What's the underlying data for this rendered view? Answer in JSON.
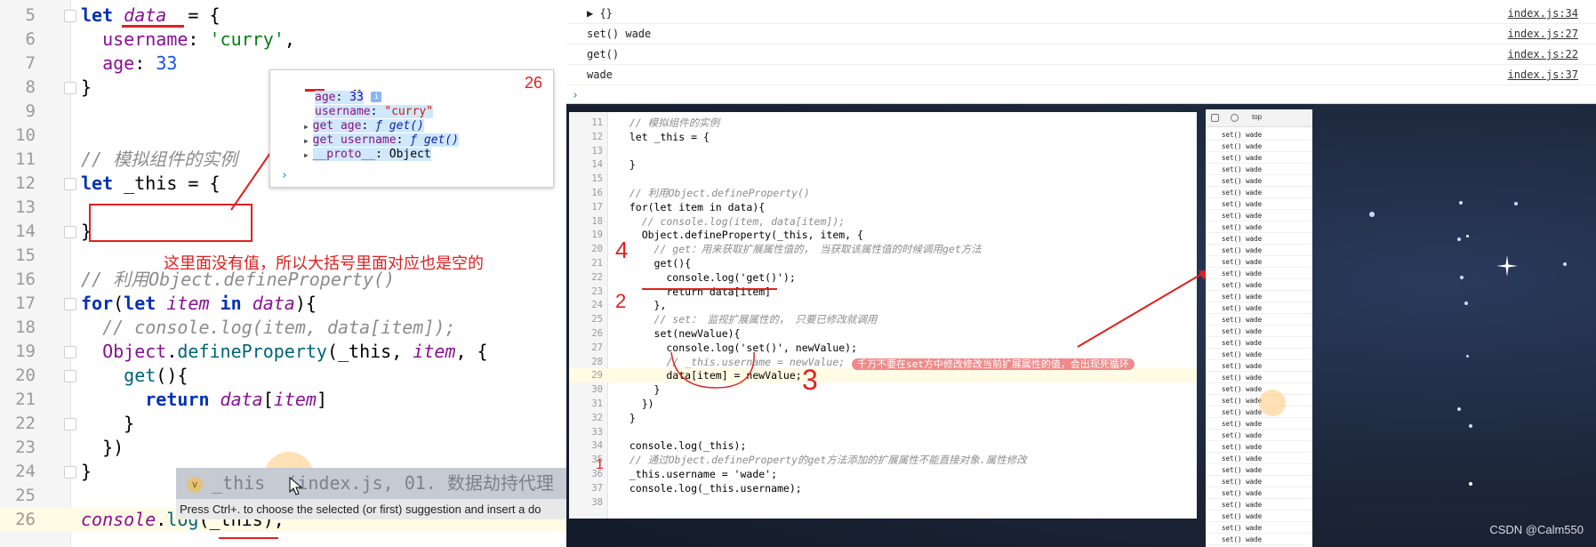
{
  "left_editor": {
    "lines": [
      {
        "n": "5",
        "parts": [
          [
            "kw",
            "let "
          ],
          [
            "ital",
            "data"
          ],
          [
            "",
            "  = {"
          ]
        ]
      },
      {
        "n": "6",
        "parts": [
          [
            "",
            "  "
          ],
          [
            "prop",
            "username"
          ],
          [
            "",
            ": "
          ],
          [
            "str",
            "'curry'"
          ],
          [
            "",
            ","
          ]
        ]
      },
      {
        "n": "7",
        "parts": [
          [
            "",
            "  "
          ],
          [
            "prop",
            "age"
          ],
          [
            "",
            ": "
          ],
          [
            "num-lit",
            "33"
          ]
        ]
      },
      {
        "n": "8",
        "parts": [
          [
            "",
            "}"
          ]
        ]
      },
      {
        "n": "9",
        "parts": []
      },
      {
        "n": "10",
        "parts": []
      },
      {
        "n": "11",
        "parts": [
          [
            "cmt",
            "// 模拟组件的实例"
          ]
        ]
      },
      {
        "n": "12",
        "parts": [
          [
            "kw",
            "let "
          ],
          [
            "",
            "_this = {"
          ]
        ]
      },
      {
        "n": "13",
        "parts": []
      },
      {
        "n": "14",
        "parts": [
          [
            "",
            "}"
          ]
        ]
      },
      {
        "n": "15",
        "parts": []
      },
      {
        "n": "16",
        "parts": [
          [
            "cmt",
            "// 利用Object.defineProperty()"
          ]
        ]
      },
      {
        "n": "17",
        "parts": [
          [
            "kw",
            "for"
          ],
          [
            "",
            "("
          ],
          [
            "kw",
            "let "
          ],
          [
            "ital",
            "item"
          ],
          [
            "kw",
            " in "
          ],
          [
            "ital",
            "data"
          ],
          [
            "",
            "){"
          ]
        ]
      },
      {
        "n": "18",
        "parts": [
          [
            "cmt",
            "  // console.log(item, data[item]);"
          ]
        ]
      },
      {
        "n": "19",
        "parts": [
          [
            "",
            "  "
          ],
          [
            "prop",
            "Object"
          ],
          [
            "",
            "."
          ],
          [
            "fn",
            "defineProperty"
          ],
          [
            "",
            "(_this, "
          ],
          [
            "ital",
            "item"
          ],
          [
            "",
            ", {"
          ]
        ]
      },
      {
        "n": "20",
        "parts": [
          [
            "",
            "    "
          ],
          [
            "fn",
            "get"
          ],
          [
            "",
            "(){"
          ]
        ]
      },
      {
        "n": "21",
        "parts": [
          [
            "",
            "      "
          ],
          [
            "kw",
            "return "
          ],
          [
            "ital",
            "data"
          ],
          [
            "",
            "["
          ],
          [
            "ital",
            "item"
          ],
          [
            "",
            "]"
          ]
        ]
      },
      {
        "n": "22",
        "parts": [
          [
            "",
            "    }"
          ]
        ]
      },
      {
        "n": "23",
        "parts": [
          [
            "",
            "  })"
          ]
        ]
      },
      {
        "n": "24",
        "parts": [
          [
            "",
            "}"
          ]
        ]
      },
      {
        "n": "25",
        "parts": []
      },
      {
        "n": "26",
        "parts": [
          [
            "ital",
            "console"
          ],
          [
            "",
            "."
          ],
          [
            "fn",
            "log"
          ],
          [
            "",
            "(_this);"
          ]
        ]
      }
    ],
    "popup": {
      "header": "{}",
      "count": "26",
      "rows": [
        {
          "key": "age",
          "sep": ": ",
          "val": "33",
          "kind": "num"
        },
        {
          "key": "username",
          "sep": ": ",
          "val": "\"curry\"",
          "kind": "str"
        },
        {
          "key": "get age",
          "sep": ": ",
          "val": "ƒ get()",
          "kind": "fn"
        },
        {
          "key": "get username",
          "sep": ": ",
          "val": "ƒ get()",
          "kind": "fn"
        },
        {
          "key": "__proto__",
          "sep": ": ",
          "val": "Object",
          "kind": "plain"
        }
      ],
      "prompt": "›"
    },
    "annotation": "这里面没有值，所以大括号里面对应也是空的",
    "autocomplete": {
      "icon": "v",
      "item": "_this  (index.js, 01. 数据劫持代理",
      "hint": "Press Ctrl+. to choose the selected (or first) suggestion and insert a do"
    }
  },
  "top_console": {
    "rows": [
      {
        "msg": "▶ {}",
        "src": "index.js:34"
      },
      {
        "msg": "set() wade",
        "src": "index.js:27"
      },
      {
        "msg": "get()",
        "src": "index.js:22"
      },
      {
        "msg": "wade",
        "src": "index.js:37"
      }
    ],
    "prompt": "›"
  },
  "inner_editor": {
    "lines": [
      {
        "n": "11",
        "t": "  // 模拟组件的实例",
        "c": "cmt"
      },
      {
        "n": "12",
        "t": "  let _this = {",
        "c": ""
      },
      {
        "n": "13",
        "t": "",
        "c": ""
      },
      {
        "n": "14",
        "t": "  }",
        "c": ""
      },
      {
        "n": "15",
        "t": "",
        "c": ""
      },
      {
        "n": "16",
        "t": "  // 利用Object.defineProperty()",
        "c": "cmt"
      },
      {
        "n": "17",
        "t": "  for(let item in data){",
        "c": ""
      },
      {
        "n": "18",
        "t": "    // console.log(item, data[item]);",
        "c": "cmt"
      },
      {
        "n": "19",
        "t": "    Object.defineProperty(_this, item, {",
        "c": ""
      },
      {
        "n": "20",
        "t": "      // get：用来获取扩展属性值的， 当获取该属性值的时候调用get方法",
        "c": "cmt"
      },
      {
        "n": "21",
        "t": "      get(){",
        "c": ""
      },
      {
        "n": "22",
        "t": "        console.log('get()');",
        "c": ""
      },
      {
        "n": "23",
        "t": "        return data[item]",
        "c": ""
      },
      {
        "n": "24",
        "t": "      },",
        "c": ""
      },
      {
        "n": "25",
        "t": "      // set： 监视扩展属性的， 只要已修改就调用",
        "c": "cmt"
      },
      {
        "n": "26",
        "t": "      set(newValue){",
        "c": ""
      },
      {
        "n": "27",
        "t": "        console.log('set()', newValue);",
        "c": ""
      },
      {
        "n": "28",
        "t": "        // _this.username = newValue;",
        "c": "cmt"
      },
      {
        "n": "29",
        "t": "        data[item] = newValue;",
        "c": ""
      },
      {
        "n": "30",
        "t": "      }",
        "c": ""
      },
      {
        "n": "31",
        "t": "    })",
        "c": ""
      },
      {
        "n": "32",
        "t": "  }",
        "c": ""
      },
      {
        "n": "33",
        "t": "",
        "c": ""
      },
      {
        "n": "34",
        "t": "  console.log(_this);",
        "c": ""
      },
      {
        "n": "35",
        "t": "  // 通过Object.defineProperty的get方法添加的扩展属性不能直接对象.属性修改",
        "c": "cmt"
      },
      {
        "n": "36",
        "t": "  _this.username = 'wade';",
        "c": ""
      },
      {
        "n": "37",
        "t": "  console.log(_this.username);",
        "c": ""
      },
      {
        "n": "38",
        "t": "",
        "c": ""
      }
    ],
    "warning": "千万不要在set方中修改修改当前扩展属性的值，会出现死循环",
    "marks": {
      "one": "1",
      "two": "2",
      "three": "3",
      "four": "4"
    }
  },
  "inner_devtools": {
    "top_label": "top",
    "row_text": "set() wade",
    "row_count": 36
  },
  "watermark": "CSDN @Calm550"
}
